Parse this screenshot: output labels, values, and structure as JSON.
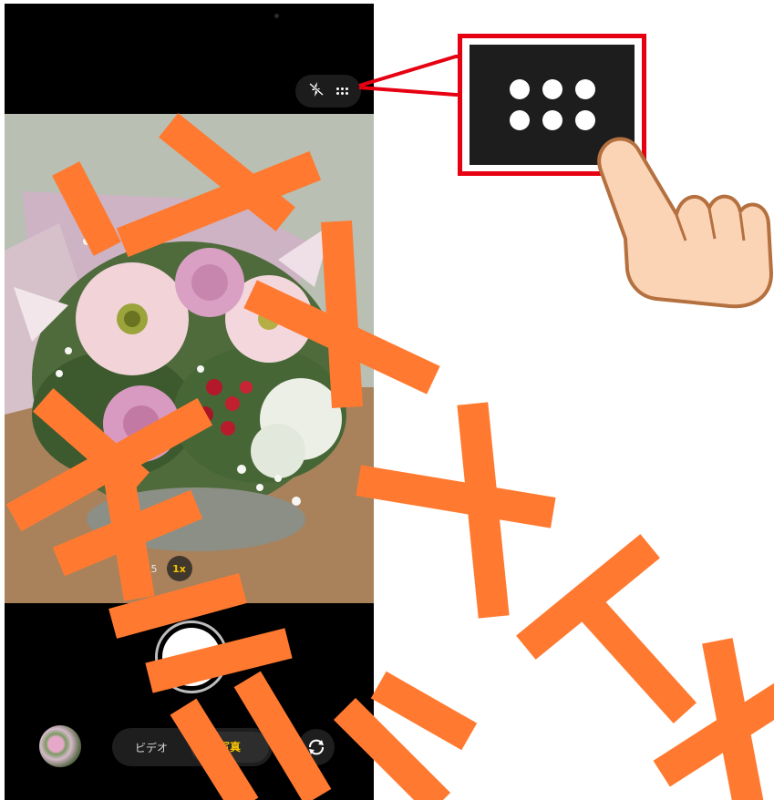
{
  "camera": {
    "zoom_options": [
      "0.5",
      "1x"
    ],
    "modes": [
      "ビデオ",
      "写真"
    ],
    "active_mode": "写真"
  },
  "icons": {
    "flash": "flash-off-icon",
    "settings": "grid-menu-icon",
    "switch": "switch-camera-icon",
    "pointer": "hand-pointer-icon"
  },
  "colors": {
    "accent": "#f6c200",
    "callout": "#e60012",
    "watermark": "#ff7a30"
  }
}
